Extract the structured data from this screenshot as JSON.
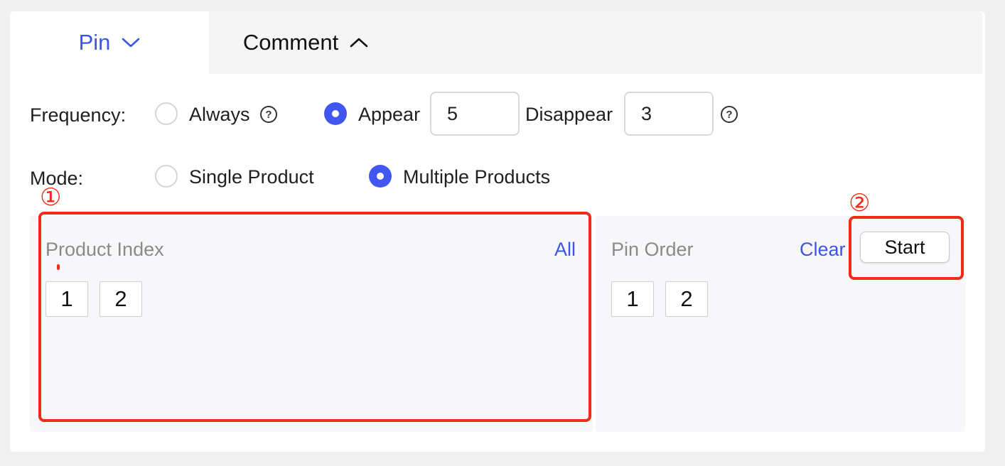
{
  "tabs": [
    {
      "label": "Pin",
      "icon": "chevron-down-icon"
    },
    {
      "label": "Comment",
      "icon": "chevron-up-icon"
    }
  ],
  "frequency": {
    "label": "Frequency:",
    "options": [
      {
        "label": "Always",
        "selected": false
      },
      {
        "label": "Appear",
        "selected": true
      }
    ],
    "appear_value": "5",
    "disappear_label": "Disappear",
    "disappear_value": "3",
    "help_icon": "question-circle-icon"
  },
  "mode": {
    "label": "Mode:",
    "options": [
      {
        "label": "Single Product",
        "selected": false
      },
      {
        "label": "Multiple Products",
        "selected": true
      }
    ]
  },
  "product_index": {
    "title": "Product Index",
    "all_label": "All",
    "items": [
      "1",
      "2"
    ]
  },
  "pin_order": {
    "title": "Pin Order",
    "clear_label": "Clear",
    "start_label": "Start",
    "items": [
      "1",
      "2"
    ]
  },
  "annotations": {
    "marker_1": "①",
    "marker_2": "②",
    "color": "#f02b1a"
  },
  "colors": {
    "accent": "#3d55e6",
    "radio_on": "#4257ef"
  }
}
